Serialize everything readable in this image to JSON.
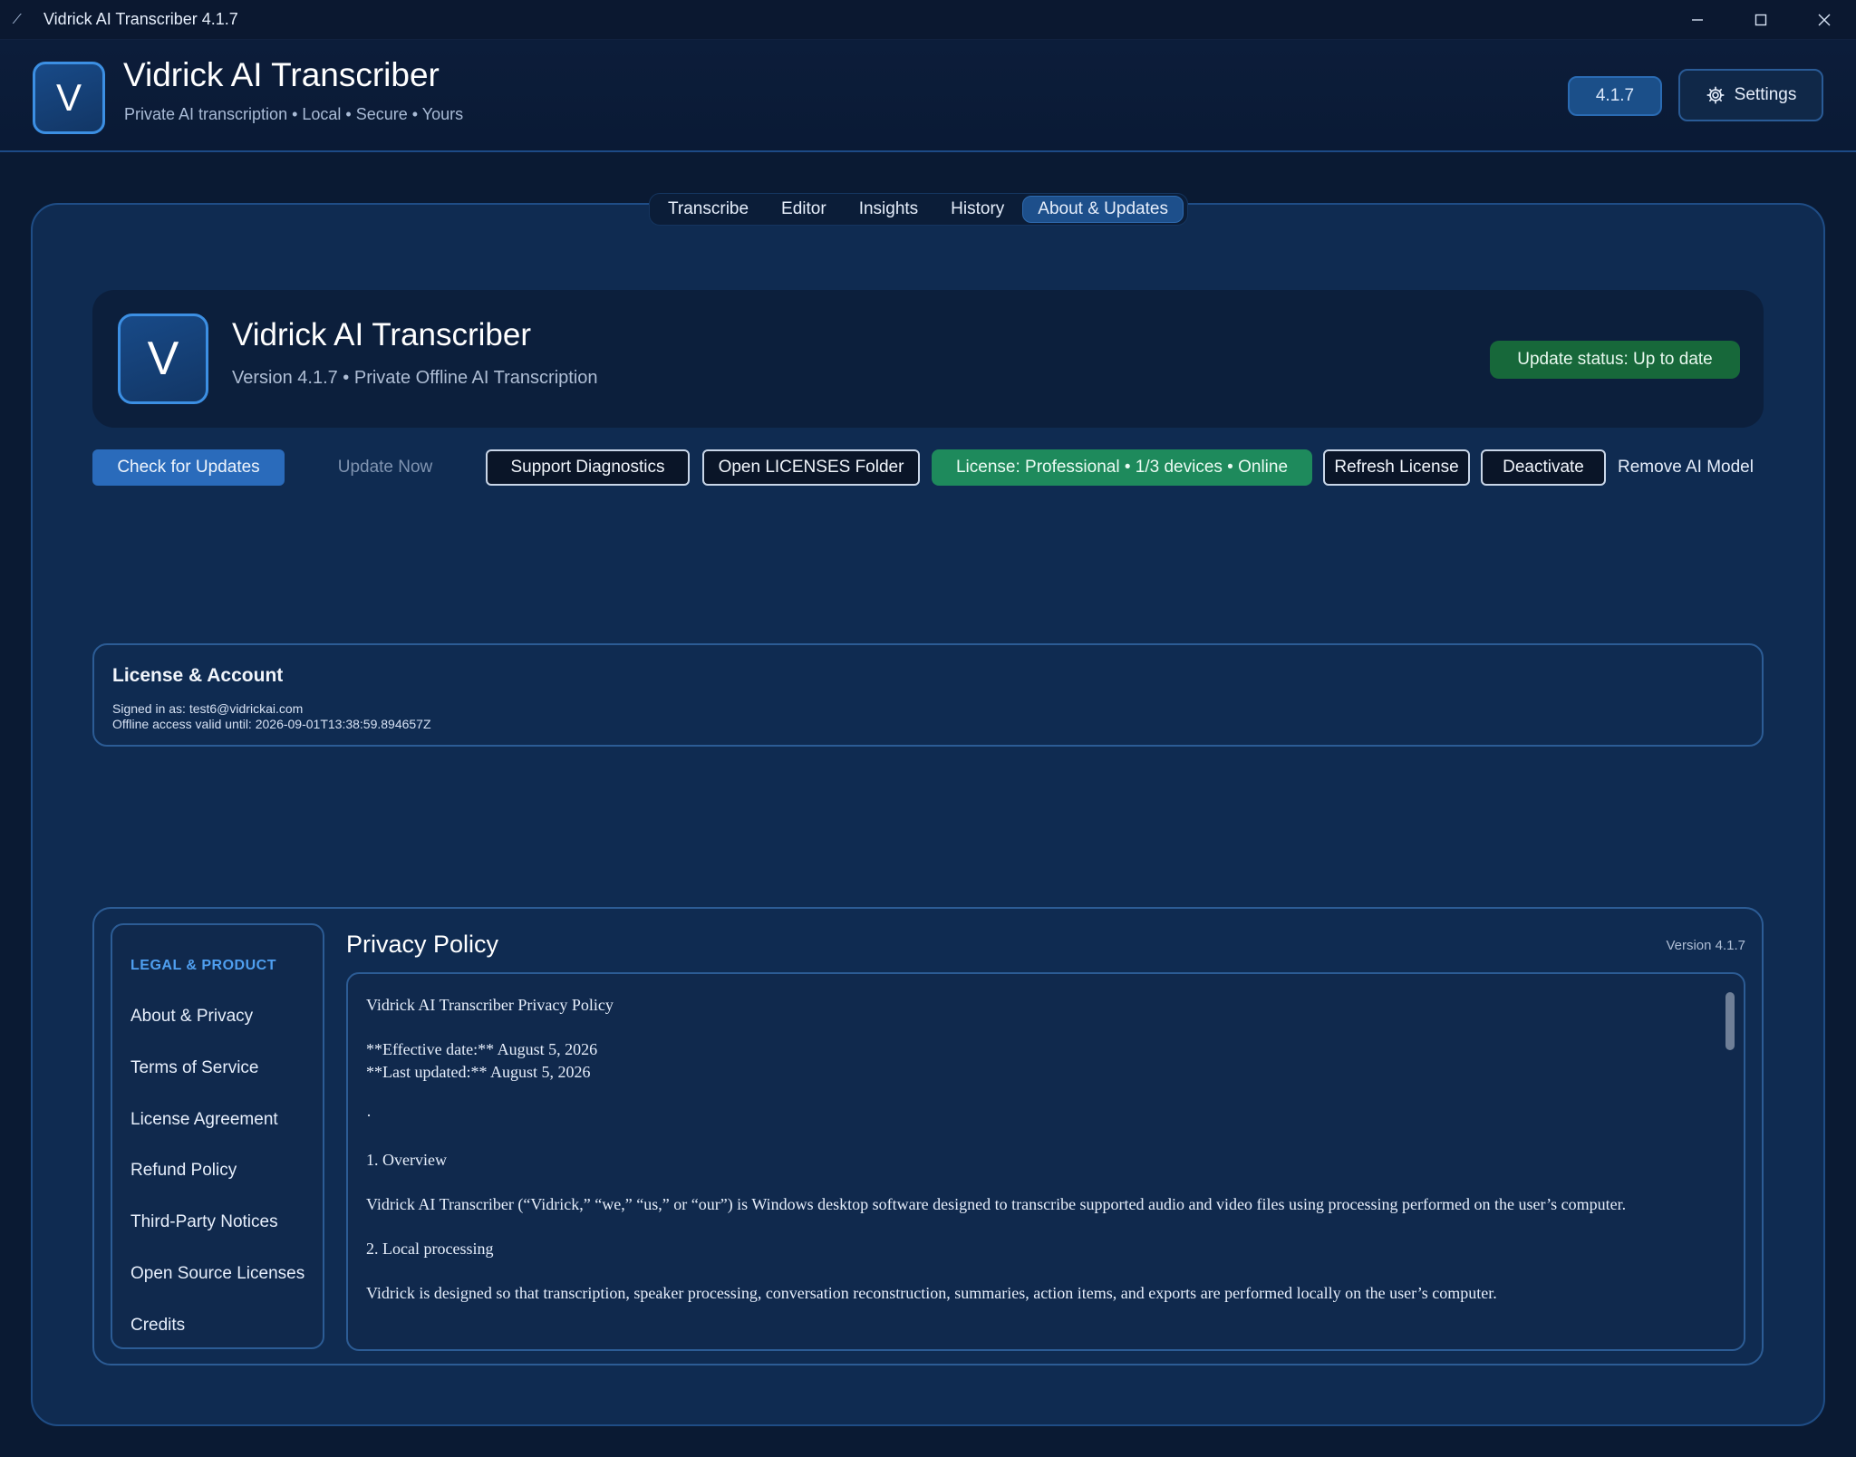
{
  "window": {
    "title": "Vidrick AI Transcriber 4.1.7"
  },
  "header": {
    "logo_letter": "V",
    "title": "Vidrick AI Transcriber",
    "subtitle": "Private AI transcription • Local • Secure • Yours",
    "version_pill": "4.1.7",
    "settings_label": "Settings"
  },
  "tabs": [
    {
      "label": "Transcribe",
      "active": false
    },
    {
      "label": "Editor",
      "active": false
    },
    {
      "label": "Insights",
      "active": false
    },
    {
      "label": "History",
      "active": false
    },
    {
      "label": "About & Updates",
      "active": true
    }
  ],
  "about": {
    "logo_letter": "V",
    "title": "Vidrick AI Transcriber",
    "subtitle": "Version 4.1.7 • Private Offline AI Transcription",
    "update_status": "Update status: Up to date"
  },
  "actions": {
    "check_updates": "Check for Updates",
    "update_now": "Update Now",
    "support_diagnostics": "Support Diagnostics",
    "open_licenses": "Open LICENSES Folder",
    "license_status": "License: Professional • 1/3 devices • Online",
    "refresh_license": "Refresh License",
    "deactivate": "Deactivate",
    "remove_model": "Remove AI Model"
  },
  "license_account": {
    "title": "License & Account",
    "signed_in": "Signed in as: test6@vidrickai.com",
    "offline_valid": "Offline access valid until: 2026-09-01T13:38:59.894657Z"
  },
  "legal": {
    "heading": "LEGAL & PRODUCT",
    "items": [
      "About & Privacy",
      "Terms of Service",
      "License Agreement",
      "Refund Policy",
      "Third-Party Notices",
      "Open Source Licenses",
      "Credits"
    ],
    "doc_title": "Privacy Policy",
    "doc_version": "Version 4.1.7",
    "doc_lines": [
      "Vidrick AI Transcriber Privacy Policy",
      "**Effective date:** August 5, 2026",
      "**Last updated:** August 5, 2026",
      "·",
      "1. Overview",
      "Vidrick AI Transcriber (“Vidrick,” “we,” “us,” or “our”) is Windows desktop software designed to transcribe supported audio and video files using processing performed on the user’s computer.",
      "2. Local processing",
      "Vidrick is designed so that transcription, speaker processing, conversation reconstruction, summaries, action items, and exports are performed locally on the user’s computer."
    ]
  },
  "colors": {
    "background": "#0a1a33",
    "panel": "#0f2b51",
    "accent": "#2a6bbb",
    "success": "#1e8a5c",
    "legal_heading": "#4f9ff0"
  }
}
